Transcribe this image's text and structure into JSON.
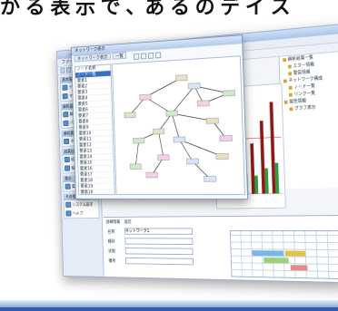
{
  "headline": "か る 表 示 で 、あ る の デ イ ス",
  "app": {
    "title": "ノイズ解析システム",
    "menu": [
      "ファイル(F)",
      "表示(V)",
      "解析(A)",
      "検索(S)",
      "ツール(T)",
      "ウィンドウ(W)",
      "ヘルプ(H)"
    ]
  },
  "left_nav": {
    "groups": [
      {
        "header": "基本情報",
        "items": [
          "データ入力",
          "マスタ管理"
        ]
      },
      {
        "header": "解析設定",
        "items": [
          "解析条件設定",
          "パラメータ"
        ]
      },
      {
        "header": "解析実行",
        "items": [
          "ネットワーク"
        ]
      },
      {
        "header": "結果出力",
        "items": [
          "結果一覧",
          "帳票出力"
        ]
      },
      {
        "header": "集計",
        "items": [
          "集計表"
        ]
      },
      {
        "header": "その他",
        "items": [
          "システム設定",
          "ヘルプ"
        ]
      }
    ]
  },
  "right_tree": {
    "items": [
      "解析結果一覧",
      "エラー情報",
      "警告情報",
      "ネットワーク構成",
      "ノード一覧",
      "リンク一覧",
      "属性情報",
      "グラフ表示"
    ]
  },
  "dialog": {
    "title": "ネットワーク表示",
    "tabs": [
      "ネットワーク表示",
      "一覧"
    ],
    "list": [
      "ノード名称",
      "ノード一覧",
      "要素1",
      "要素2",
      "要素3",
      "要素4",
      "要素5",
      "要素6",
      "要素7",
      "要素8",
      "要素9",
      "要素10",
      "要素11",
      "要素12",
      "要素13",
      "要素14",
      "要素15",
      "要素16",
      "要素17",
      "要素18",
      "要素19",
      "要素20"
    ],
    "selected_index": 1
  },
  "chart_data": {
    "type": "bar",
    "categories": [
      "1",
      "2",
      "3",
      "4",
      "5",
      "6"
    ],
    "series": [
      {
        "values": [
          30,
          45,
          60,
          50,
          72,
          90
        ]
      },
      {
        "values": [
          10,
          15,
          20,
          18,
          25,
          30
        ]
      }
    ],
    "colors": [
      "#8b1a1a",
      "#2f9a3a"
    ],
    "ylim": [
      0,
      100
    ]
  },
  "bottom_panel": {
    "tab_labels": [
      "詳細情報",
      "設定"
    ],
    "form_labels": [
      "名称",
      "種別",
      "状態",
      "備考"
    ],
    "form_values": [
      "ネットワーク1",
      "",
      "",
      ""
    ]
  },
  "colors": {
    "accent": "#3b6fc2",
    "bottom_bar": "#2b5da8"
  }
}
